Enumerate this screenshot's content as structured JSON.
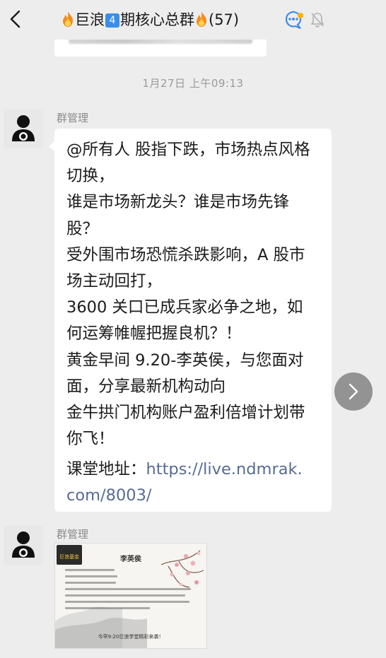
{
  "header": {
    "title_prefix": "巨浪",
    "title_badge": "4",
    "title_main": "期核心总群",
    "member_count": "(57)",
    "icons": [
      "back-icon",
      "fire-emoji-icon",
      "number-4-badge-icon",
      "fire-emoji-icon",
      "search-chat-icon",
      "mute-bell-icon"
    ]
  },
  "timestamp": "1月27日 上午09:13",
  "messages": [
    {
      "sender": "群管理",
      "text": "@所有人 股指下跌，市场热点风格\n切换，\n谁是市场新龙头？谁是市场先锋\n股？\n受外围市场恐慌杀跌影响，A 股市\n场主动回打，\n3600 关口已成兵家必争之地，如\n何运筹帷幄把握良机？！\n黄金早间 9.20-李英侯，与您面对\n面，分享最新机构动向\n金牛拱门机构账户盈利倍增计划带\n你飞！",
      "link_label": "课堂地址：",
      "link_url": "https://live.ndmrak.\ncom/8003/"
    },
    {
      "sender": "群管理",
      "image": {
        "logo_text": "巨浪基金",
        "name": "李英侯",
        "caption": "今早9:20巨浪学堂精彩来袭！"
      }
    }
  ],
  "colors": {
    "background": "#ededed",
    "bubble": "#ffffff",
    "link": "#576b95",
    "badge": "#3b8ee8"
  }
}
